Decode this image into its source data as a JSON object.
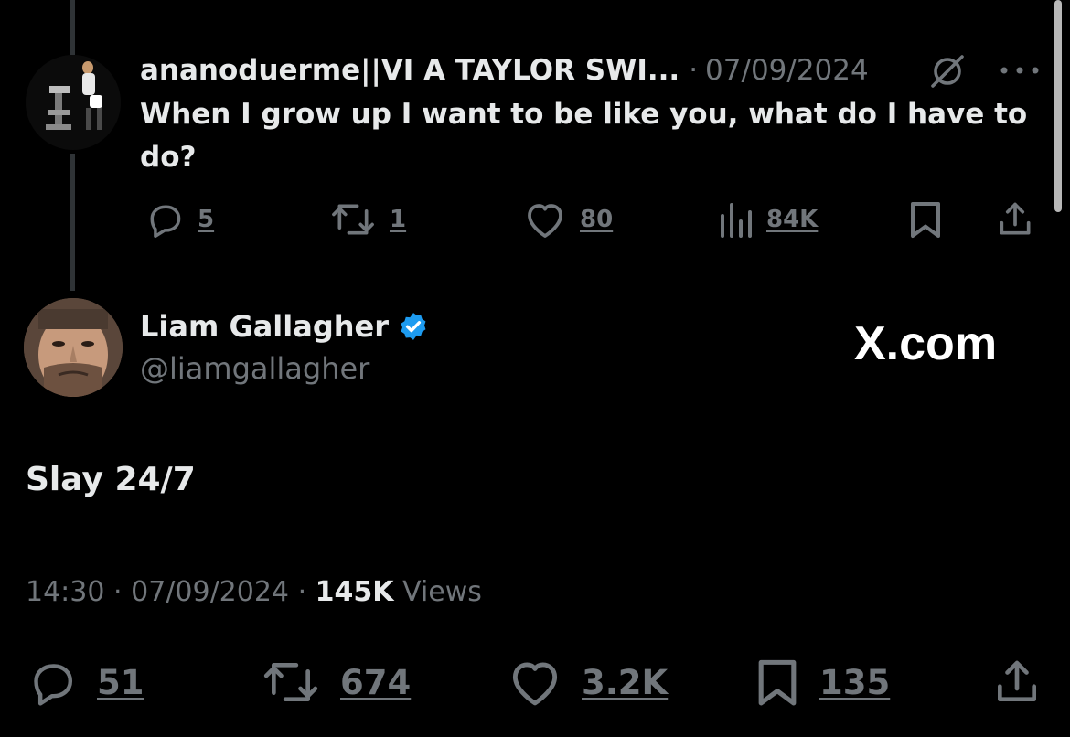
{
  "reply_tweet": {
    "display_name": "ananoduerme||VI A TAYLOR SWI...",
    "separator": "·",
    "date": "07/09/2024",
    "text": "When I grow up I want to be like you, what do I have to do?",
    "actions": {
      "replies": "5",
      "reposts": "1",
      "likes": "80",
      "views": "84K"
    }
  },
  "main_tweet": {
    "display_name": "Liam Gallagher",
    "handle": "@liamgallagher",
    "verified": true,
    "watermark": "X.com",
    "text": "Slay 24/7",
    "time": "14:30",
    "sep1": "·",
    "date": "07/09/2024",
    "sep2": "·",
    "views_count": "145K",
    "views_label": "Views",
    "actions": {
      "replies": "51",
      "reposts": "674",
      "likes": "3.2K",
      "bookmarks": "135"
    }
  },
  "colors": {
    "background": "#000000",
    "text_primary": "#e7e9ea",
    "text_secondary": "#71767b",
    "verified_blue": "#1d9bf0",
    "thread_line": "#2f3336"
  }
}
